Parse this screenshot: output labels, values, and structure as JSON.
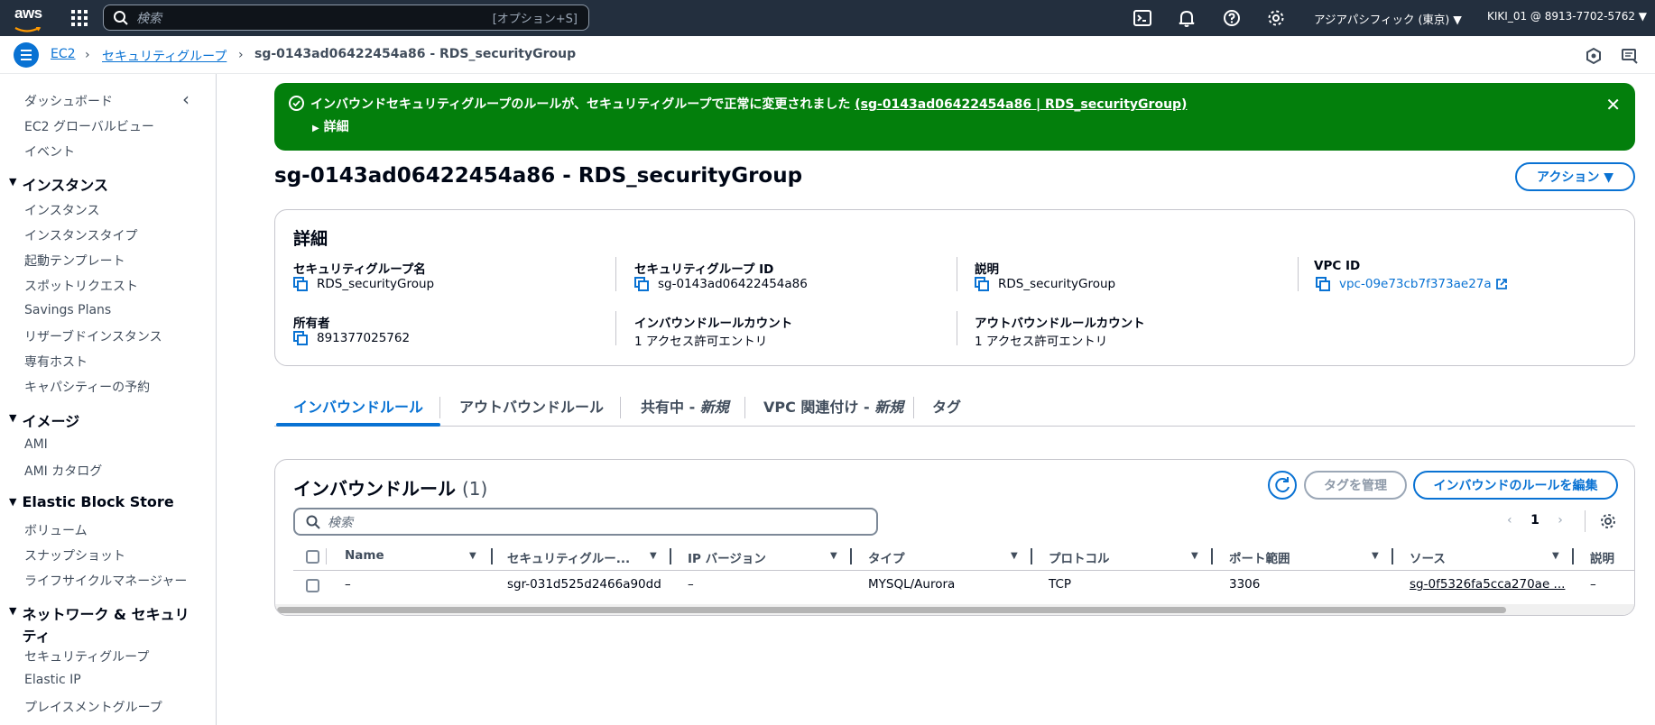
{
  "topbar": {
    "logo": "aws",
    "search_placeholder": "検索",
    "search_shortcut": "[オプション+S]",
    "region": "アジアパシフィック (東京) ▼",
    "account": "KIKI_01 @ 8913-7702-5762 ▼"
  },
  "breadcrumb": {
    "items": [
      "EC2",
      "セキュリティグループ",
      "sg-0143ad06422454a86 - RDS_securityGroup"
    ]
  },
  "sidebar": {
    "top_items": [
      "ダッシュボード",
      "EC2 グローバルビュー",
      "イベント"
    ],
    "sections": [
      {
        "title": "インスタンス",
        "items": [
          "インスタンス",
          "インスタンスタイプ",
          "起動テンプレート",
          "スポットリクエスト",
          "Savings Plans",
          "リザーブドインスタンス",
          "専有ホスト",
          "キャパシティーの予約"
        ]
      },
      {
        "title": "イメージ",
        "items": [
          "AMI",
          "AMI カタログ"
        ]
      },
      {
        "title": "Elastic Block Store",
        "items": [
          "ボリューム",
          "スナップショット",
          "ライフサイクルマネージャー"
        ]
      },
      {
        "title_line1": "ネットワーク & セキュリ",
        "title_line2": "ティ",
        "items": [
          "セキュリティグループ",
          "Elastic IP",
          "プレイスメントグループ"
        ]
      }
    ]
  },
  "flash": {
    "message": "インバウンドセキュリティグループのルールが、セキュリティグループで正常に変更されました",
    "link": "(sg-0143ad06422454a86 | RDS_securityGroup)",
    "details_toggle": "詳細"
  },
  "page": {
    "title": "sg-0143ad06422454a86 - RDS_securityGroup",
    "action_button": "アクション ▼"
  },
  "details": {
    "heading": "詳細",
    "sg_name_label": "セキュリティグループ名",
    "sg_name": "RDS_securityGroup",
    "sg_id_label": "セキュリティグループ ID",
    "sg_id": "sg-0143ad06422454a86",
    "desc_label": "説明",
    "desc": "RDS_securityGroup",
    "vpc_label": "VPC ID",
    "vpc": "vpc-09e73cb7f373ae27a",
    "owner_label": "所有者",
    "owner": "891377025762",
    "inbound_count_label": "インバウンドルールカウント",
    "inbound_count": "1 アクセス許可エントリ",
    "outbound_count_label": "アウトバウンドルールカウント",
    "outbound_count": "1 アクセス許可エントリ"
  },
  "tabs": {
    "inbound": "インバウンドルール",
    "outbound": "アウトバウンドルール",
    "sharing": "共有中 - ",
    "sharing_new": "新規",
    "vpc_assoc": "VPC 関連付け - ",
    "vpc_assoc_new": "新規",
    "tags": "タグ"
  },
  "rules": {
    "heading": "インバウンドルール",
    "count": "(1)",
    "manage_tags": "タグを管理",
    "edit_rules": "インバウンドのルールを編集",
    "search_placeholder": "検索",
    "page": "1",
    "columns": [
      "Name",
      "セキュリティグルー...",
      "IP バージョン",
      "タイプ",
      "プロトコル",
      "ポート範囲",
      "ソース",
      "説明"
    ],
    "rows": [
      {
        "name": "–",
        "rule_id": "sgr-031d525d2466a90dd",
        "ip_version": "–",
        "type": "MYSQL/Aurora",
        "protocol": "TCP",
        "port": "3306",
        "source": "sg-0f5326fa5cca270ae ...",
        "desc": "–"
      }
    ]
  }
}
